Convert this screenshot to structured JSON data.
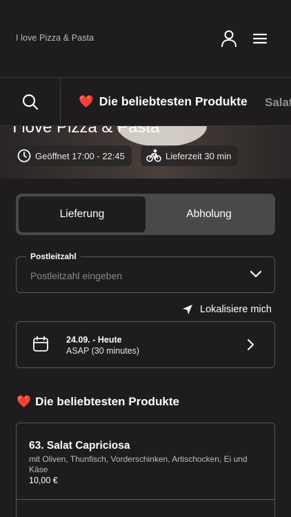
{
  "header": {
    "brand": "I love Pizza & Pasta",
    "user_icon": "user-icon",
    "menu_icon": "hamburger-menu-icon"
  },
  "categories": {
    "search_icon": "search-icon",
    "active": {
      "emoji": "❤️",
      "label": "Die beliebtesten Produkte"
    },
    "next": {
      "label": "Salat"
    }
  },
  "hero": {
    "title": "I love Pizza & Pasta",
    "opening": {
      "icon": "clock-icon",
      "text": "Geöffnet 17:00 - 22:45"
    },
    "delivery": {
      "icon": "bicycle-icon",
      "text": "Lieferzeit 30 min"
    }
  },
  "mode_toggle": {
    "delivery_label": "Lieferung",
    "pickup_label": "Abholung",
    "selected": "Lieferung"
  },
  "postcode": {
    "label": "Postleitzahl",
    "placeholder": "Postleitzahl eingeben",
    "value": ""
  },
  "locate": {
    "icon": "location-arrow-icon",
    "label": "Lokalisiere mich"
  },
  "schedule": {
    "icon": "calendar-icon",
    "date": "24.09. - Heute",
    "time": "ASAP (30 minutes)"
  },
  "popular": {
    "emoji": "❤️",
    "title": "Die beliebtesten Produkte",
    "products": [
      {
        "name": "63. Salat Capriciosa",
        "description": "mit Oliven, Thunfisch, Vorderschinken, Artischocken, Ei und Käse",
        "price": "10,00 €"
      }
    ]
  },
  "colors": {
    "background": "#1e1c1d",
    "border": "#5a5858",
    "toggle_bg": "#4a4848"
  }
}
